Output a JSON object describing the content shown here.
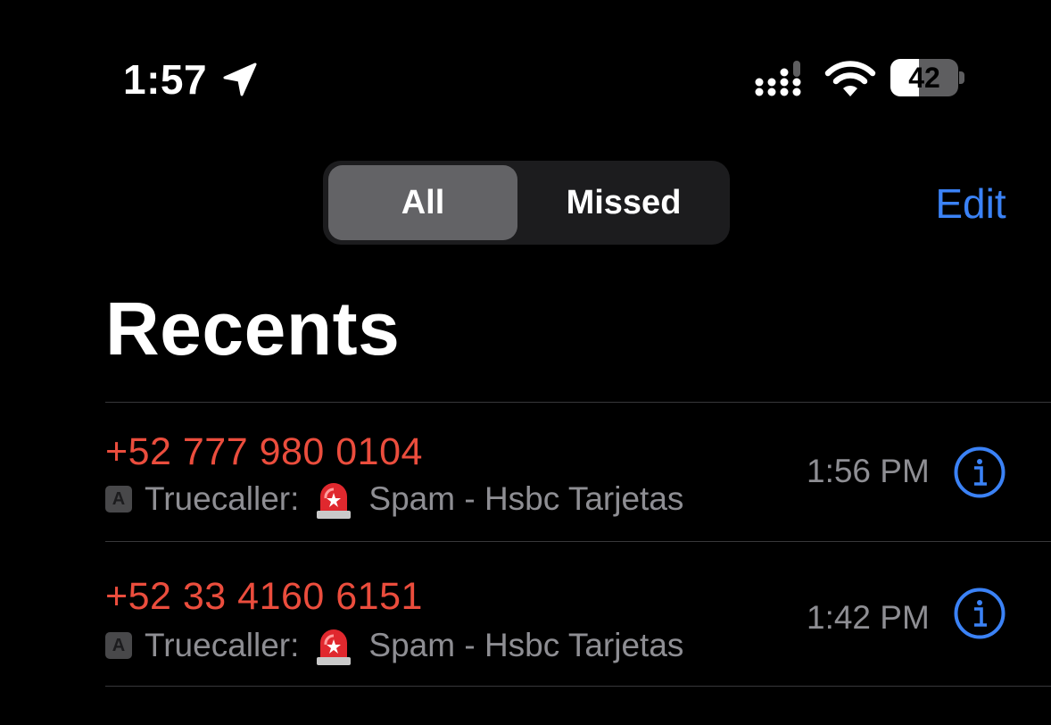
{
  "status_bar": {
    "time": "1:57",
    "battery_level": "42",
    "battery_fraction": 0.42
  },
  "segmented_control": {
    "selected": "All",
    "segments": [
      "All",
      "Missed"
    ]
  },
  "header": {
    "edit_label": "Edit"
  },
  "page_title": "Recents",
  "calls": [
    {
      "number": "+52 777 980 0104",
      "source_badge": "A",
      "source_label": "Truecaller:",
      "source_icon": "rotating-light-emoji",
      "description": "Spam - Hsbc Tarjetas",
      "time": "1:56 PM",
      "info_icon": "info-circle-icon"
    },
    {
      "number": "+52 33 4160 6151",
      "source_badge": "A",
      "source_label": "Truecaller:",
      "source_icon": "rotating-light-emoji",
      "description": "Spam - Hsbc Tarjetas",
      "time": "1:42 PM",
      "info_icon": "info-circle-icon"
    }
  ],
  "colors": {
    "background": "#000000",
    "missed_call_red": "#eb4d3d",
    "accent_blue": "#3b82f6",
    "secondary_text": "#8e8e93",
    "segment_selected": "#636366",
    "segment_track": "#1c1c1e"
  }
}
